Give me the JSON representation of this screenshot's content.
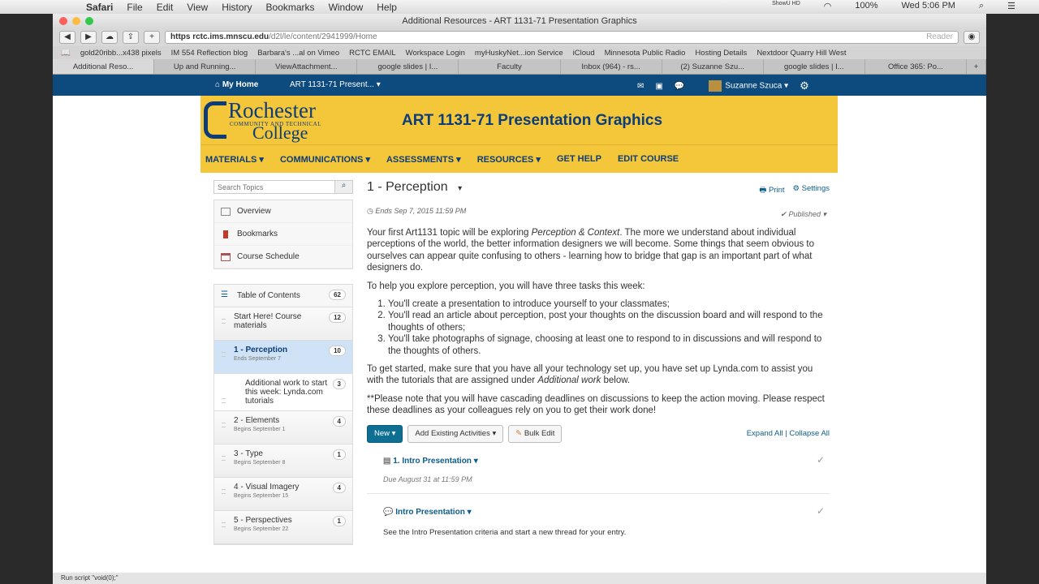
{
  "menubar": {
    "apple": "",
    "app": "Safari",
    "items": [
      "File",
      "Edit",
      "View",
      "History",
      "Bookmarks",
      "Window",
      "Help"
    ],
    "battery": "100%",
    "clock": "Wed 5:06 PM",
    "showuhd": "ShowU HD"
  },
  "browser": {
    "title": "Additional Resources - ART 1131-71 Presentation Graphics",
    "url_host": "https  rctc.ims.mnscu.edu",
    "url_path": "/d2l/le/content/2941999/Home",
    "reader": "Reader",
    "bookmarks": [
      "gold20ribb...x438 pixels",
      "IM 554 Reflection blog",
      "Barbara's ...al on Vimeo",
      "RCTC EMAIL",
      "Workspace Login",
      "myHuskyNet...ion Service",
      "iCloud",
      "Minnesota Public Radio",
      "Hosting Details",
      "Nextdoor Quarry Hill West"
    ],
    "tabs": [
      "Additional Reso...",
      "Up and Running...",
      "ViewAttachment...",
      "google slides | I...",
      "Faculty",
      "Inbox (964) - rs...",
      "(2) Suzanne Szu...",
      "google slides | I...",
      "Office 365: Po..."
    ],
    "status": "Run script \"void(0);\""
  },
  "nav": {
    "home": "My Home",
    "course": "ART 1131-71 Present...",
    "user": "Suzanne Szuca"
  },
  "banner": {
    "logo_name": "Rochester",
    "logo_sub": "COMMUNITY AND TECHNICAL",
    "logo_college": "College",
    "title": "ART 1131-71 Presentation Graphics"
  },
  "course_nav": [
    "MATERIALS ▾",
    "COMMUNICATIONS ▾",
    "ASSESSMENTS ▾",
    "RESOURCES ▾",
    "GET HELP",
    "EDIT COURSE"
  ],
  "sidebar": {
    "search_placeholder": "Search Topics",
    "links": [
      "Overview",
      "Bookmarks",
      "Course Schedule"
    ],
    "toc": {
      "label": "Table of Contents",
      "count": "62"
    },
    "modules": [
      {
        "title": "Start Here! Course materials",
        "date": "",
        "count": "12"
      },
      {
        "title": "1 - Perception",
        "date": "Ends September 7",
        "count": "10"
      },
      {
        "title": "Additional work to start this week: Lynda.com tutorials",
        "date": "",
        "count": "3"
      },
      {
        "title": "2 - Elements",
        "date": "Begins September 1",
        "count": "4"
      },
      {
        "title": "3 - Type",
        "date": "Begins September 8",
        "count": "1"
      },
      {
        "title": "4 - Visual Imagery",
        "date": "Begins September 15",
        "count": "4"
      },
      {
        "title": "5 - Perspectives",
        "date": "Begins September 22",
        "count": "1"
      }
    ]
  },
  "main": {
    "title": "1 - Perception",
    "print": "Print",
    "settings": "Settings",
    "ends": "Ends Sep 7, 2015 11:59 PM",
    "published": "Published",
    "p1a": "Your first Art1131 topic will be exploring ",
    "p1em": "Perception & Context",
    "p1b": ". The more we understand about individual perceptions of the world, the better information designers we will become. Some things that seem obvious to ourselves can appear quite confusing to others - learning how to bridge that gap is an important part of what designers do.",
    "p2": "To help you explore perception, you will have three tasks this week:",
    "tasks": [
      "You'll create a presentation to introduce yourself to your classmates;",
      "You'll read an article about perception, post your thoughts on the discussion board and will respond to the thoughts of others;",
      "You'll take photographs of signage, choosing at least one to respond to in discussions and will respond to the thoughts of others."
    ],
    "p3a": "To get started, make sure that you have all your technology set up, you have set up Lynda.com to assist you with the tutorials that are assigned under ",
    "p3em": "Additional work",
    "p3b": " below.",
    "p4": "**Please note that you will have cascading deadlines on discussions to keep the action moving. Please respect these deadlines as your colleagues rely on you to get their work done!",
    "new": "New ▾",
    "add_existing": "Add Existing Activities ▾",
    "bulk_edit": "Bulk Edit",
    "expand_all": "Expand All",
    "collapse_all": "Collapse All",
    "activities": [
      {
        "title": "1. Intro Presentation",
        "due": "Due August 31 at 11:59 PM"
      },
      {
        "title": "Intro Presentation",
        "desc": "See the Intro Presentation criteria and start a new thread for your entry."
      }
    ]
  }
}
